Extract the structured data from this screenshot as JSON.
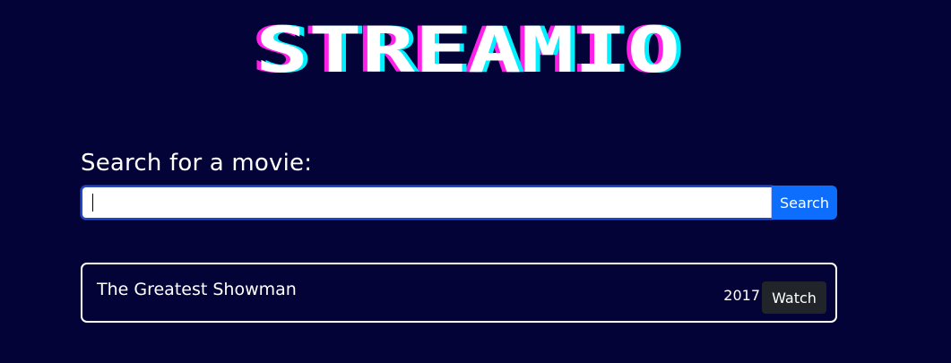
{
  "logo": {
    "text": "STREAMIO",
    "colors": {
      "main": "#ffffff",
      "shadow_left": "#ff20e8",
      "shadow_right": "#00f0ff"
    }
  },
  "search": {
    "label": "Search for a movie:",
    "value": "",
    "placeholder": "",
    "button_label": "Search"
  },
  "results": [
    {
      "title": "The Greatest Showman",
      "year": "2017",
      "action_label": "Watch"
    }
  ],
  "colors": {
    "background": "#030337",
    "primary": "#0d6efd",
    "dark_button": "#212529",
    "card_border": "#ffffff"
  }
}
